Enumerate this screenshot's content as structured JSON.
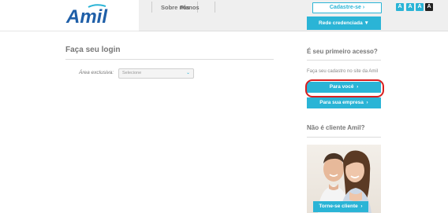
{
  "header": {
    "logo_text": "Amil",
    "nav": [
      "Sobre nós",
      "Planos"
    ],
    "cadastre_label": "Cadastre-se",
    "cadastre_arrow": "›",
    "accessibility": [
      {
        "glyph": "A",
        "color": "#2ab4d6"
      },
      {
        "glyph": "A",
        "color": "#2ab4d6"
      },
      {
        "glyph": "A",
        "color": "#2ab4d6"
      },
      {
        "glyph": "A",
        "color": "#222222"
      }
    ],
    "rede_label": "Rede credenciada",
    "rede_icon": "▼"
  },
  "login": {
    "title": "Faça seu login",
    "area_label": "Área exclusiva:",
    "area_select_value": "Selecione",
    "area_select_icon": "⌄"
  },
  "primeiro_acesso": {
    "title": "É seu primeiro acesso?",
    "text": "Faça seu cadastro no site da Amil",
    "para_voce_label": "Para você",
    "para_empresa_label": "Para sua empresa",
    "arrow": "›"
  },
  "nao_cliente": {
    "title": "Não é cliente Amil?",
    "torne_label": "Torne-se cliente",
    "arrow": "›"
  },
  "colors": {
    "accent": "#2ab4d6",
    "highlight": "#d91f1f",
    "logo_blue": "#1f5fa8"
  }
}
